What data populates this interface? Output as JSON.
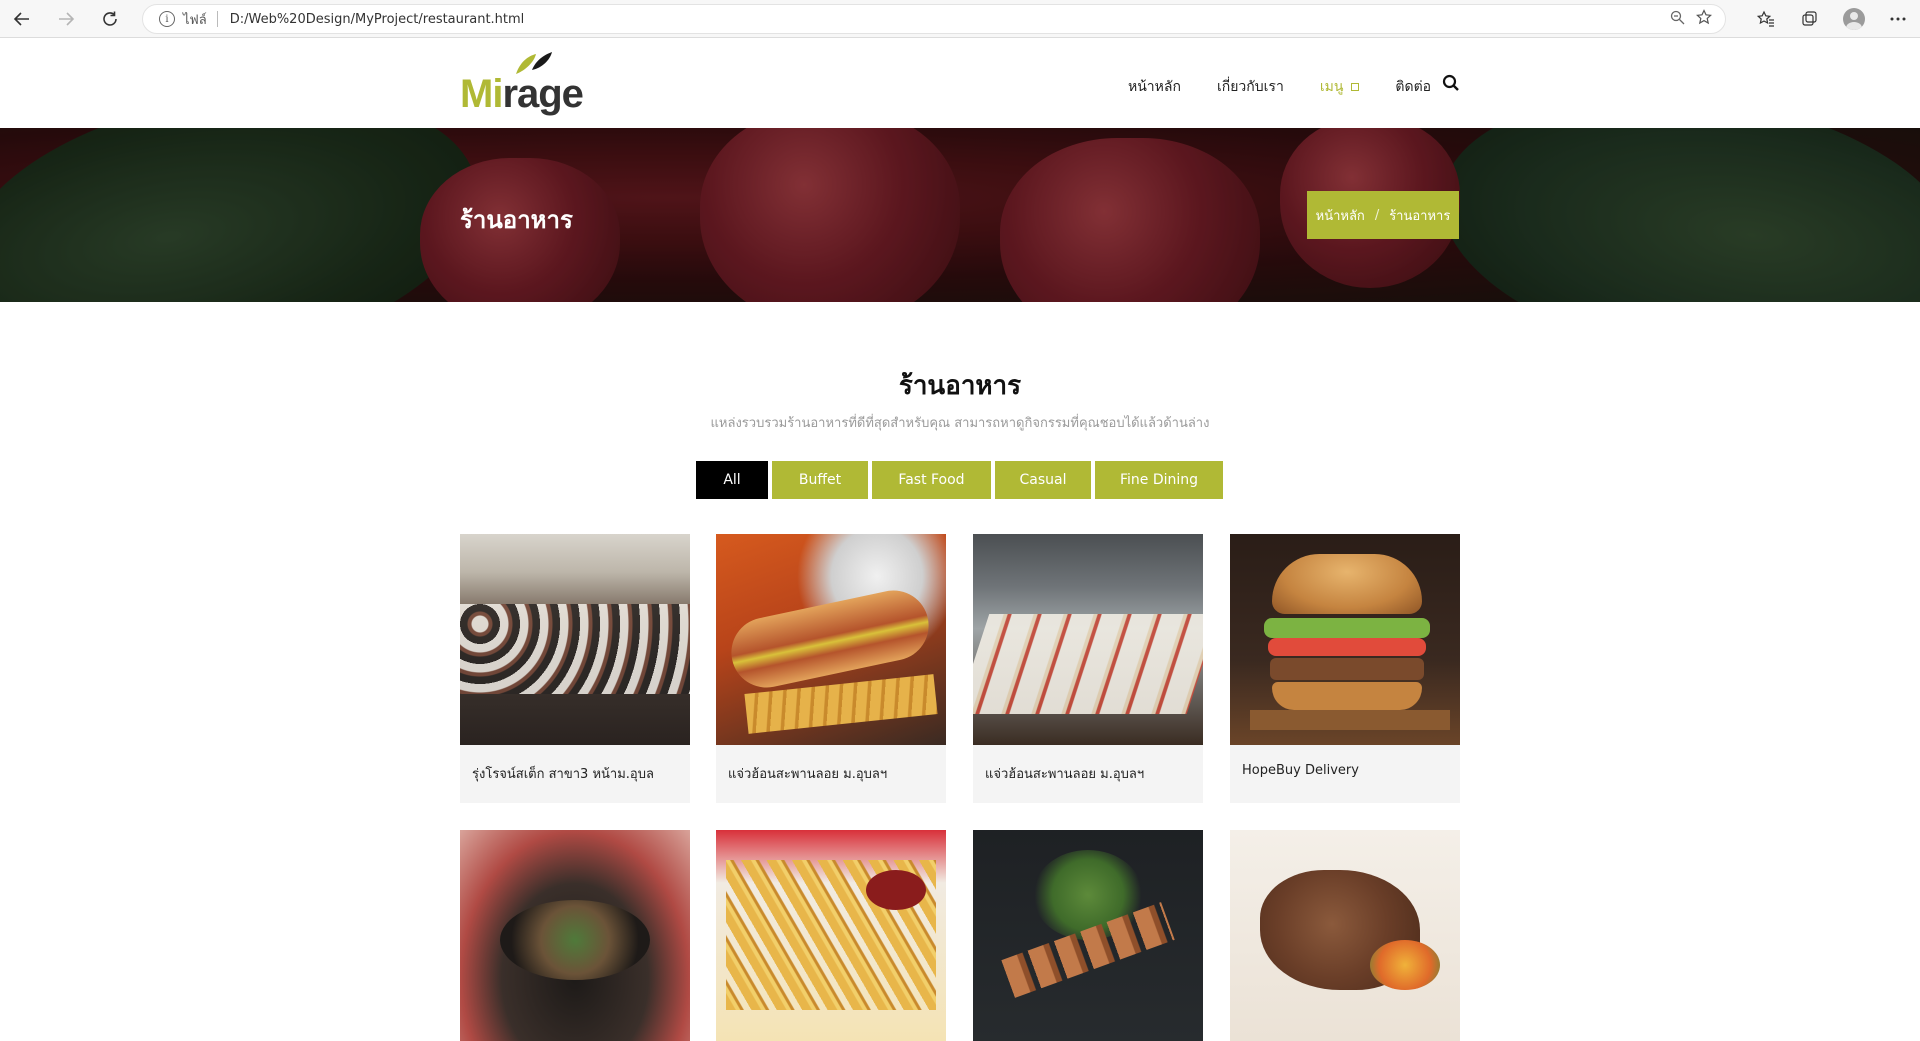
{
  "browser": {
    "scheme": "ไฟล์",
    "url": "D:/Web%20Design/MyProject/restaurant.html"
  },
  "header": {
    "logo_prefix": "Mi",
    "logo_suffix": "rage",
    "nav": [
      "หน้าหลัก",
      "เกี่ยวกับเรา",
      "เมนู",
      "ติดต่อ"
    ],
    "accent_color": "#b0b935"
  },
  "hero": {
    "title": "ร้านอาหาร",
    "breadcrumb_home": "หน้าหลัก",
    "breadcrumb_sep": "/",
    "breadcrumb_current": "ร้านอาหาร"
  },
  "section": {
    "title": "ร้านอาหาร",
    "subtitle": "แหล่งรวบรวมร้านอาหารที่ดีที่สุดสำหรับคุณ สามารถหาดูกิจกรรมที่คุณชอบได้แล้วด้านล่าง"
  },
  "filters": [
    "All",
    "Buffet",
    "Fast Food",
    "Casual",
    "Fine Dining"
  ],
  "cards": [
    {
      "name": "รุ่งโรจน์สเต็ก สาขา3 หน้าม.อุบล"
    },
    {
      "name": "แจ่วฮ้อนสะพานลอย ม.อุบลฯ"
    },
    {
      "name": "แจ่วฮ้อนสะพานลอย ม.อุบลฯ"
    },
    {
      "name": "HopeBuy Delivery"
    }
  ]
}
